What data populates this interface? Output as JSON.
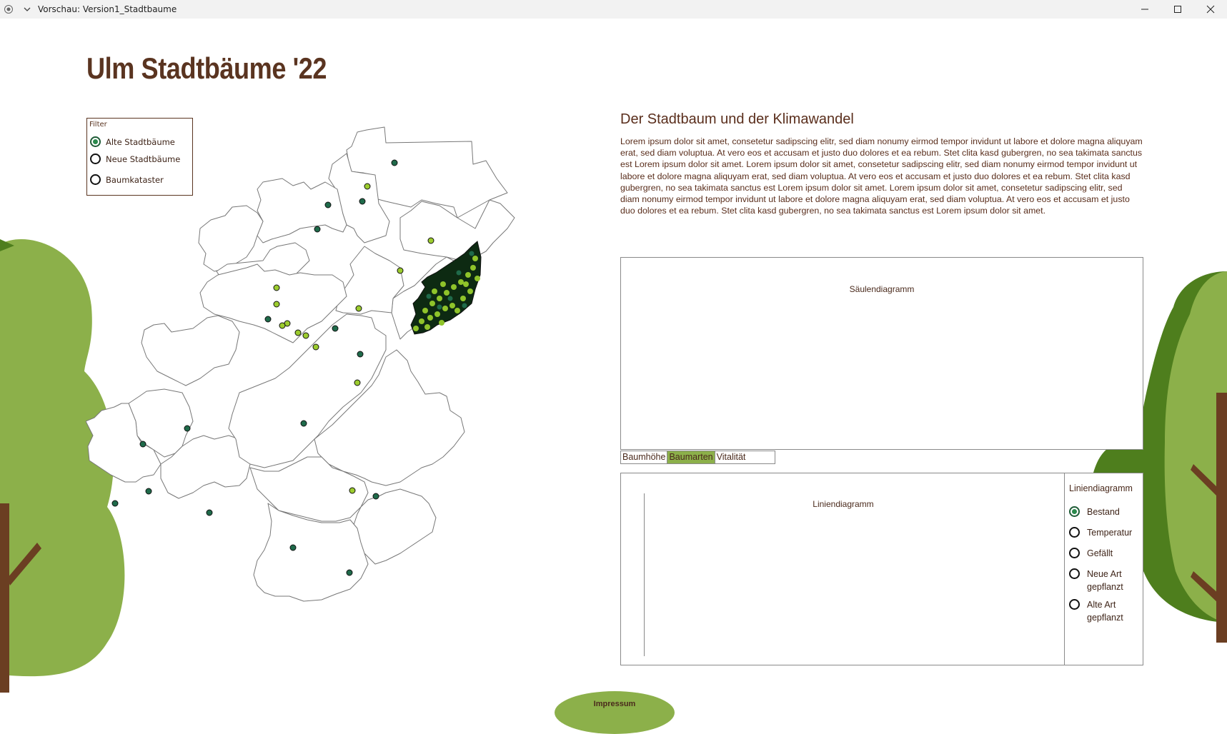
{
  "window": {
    "title": "Vorschau: Version1_Stadtbaume"
  },
  "header": {
    "title": "Ulm Stadtbäume '22"
  },
  "filter": {
    "legend": "Filter",
    "options": [
      {
        "label": "Alte Stadtbäume",
        "checked": true
      },
      {
        "label": "Neue Stadtbäume",
        "checked": false
      },
      {
        "label": "Baumkataster",
        "checked": false
      }
    ]
  },
  "article": {
    "title": "Der Stadtbaum und der Klimawandel",
    "body": "Lorem ipsum dolor sit amet, consetetur sadipscing elitr, sed diam nonumy eirmod tempor invidunt ut labore et dolore magna aliquyam erat, sed diam voluptua. At vero eos et accusam et justo duo dolores et ea rebum. Stet clita kasd gubergren, no sea takimata sanctus est Lorem ipsum dolor sit amet. Lorem ipsum dolor sit amet, consetetur sadipscing elitr, sed diam nonumy eirmod tempor invidunt ut labore et dolore magna aliquyam erat, sed diam voluptua. At vero eos et accusam et justo duo dolores et ea rebum. Stet clita kasd gubergren, no sea takimata sanctus est Lorem ipsum dolor sit amet. Lorem ipsum dolor sit amet, consetetur sadipscing elitr, sed diam nonumy eirmod tempor invidunt ut labore et dolore magna aliquyam erat, sed diam voluptua. At vero eos et accusam et justo duo dolores et ea rebum. Stet clita kasd gubergren, no sea takimata sanctus est Lorem ipsum dolor sit amet."
  },
  "bar_chart": {
    "caption": "Säulendiagramm",
    "tabs": [
      {
        "label": "Baumhöhe",
        "active": false
      },
      {
        "label": "Baumarten",
        "active": true
      },
      {
        "label": "Vitalität",
        "active": false
      }
    ]
  },
  "line_chart": {
    "caption": "Liniendiagramm",
    "side_title": "Liniendiagramm",
    "options": [
      {
        "label": "Bestand",
        "checked": true
      },
      {
        "label": "Temperatur",
        "checked": false
      },
      {
        "label": "Gefällt",
        "checked": false
      },
      {
        "label": "Neue Art gepflanzt",
        "checked": false
      },
      {
        "label": "Alte Art gepflanzt",
        "checked": false
      }
    ]
  },
  "footer": {
    "impressum_label": "Impressum"
  },
  "colors": {
    "title_brown": "#5a3420",
    "tree_light": "#8cb04a",
    "tree_dark": "#4e7e1d",
    "trunk": "#6b3e22",
    "dot_dark": "#1f6a4a",
    "dot_light": "#9ccc2e"
  }
}
